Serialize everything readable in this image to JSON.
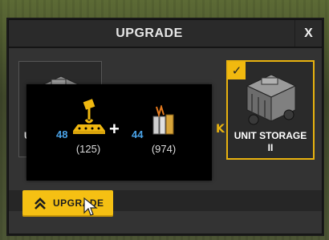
{
  "dialog": {
    "title": "UPGRADE",
    "close_label": "X"
  },
  "current_unit": {
    "label": "U"
  },
  "target_unit": {
    "label_line1": "UNIT STORAGE",
    "label_line2": "II",
    "selected": true
  },
  "transition_arrow": "K",
  "requirements": {
    "items": [
      {
        "icon": "crane-hook-icon",
        "required": "48",
        "owned": "(125)"
      },
      {
        "icon": "wood-planks-icon",
        "required": "44",
        "owned": "(974)"
      }
    ],
    "separator": "+"
  },
  "upgrade_button": {
    "label": "UPGRADE"
  },
  "colors": {
    "accent": "#f5c013",
    "required_count": "#4aa3e8",
    "panel": "#2f2f2f"
  }
}
